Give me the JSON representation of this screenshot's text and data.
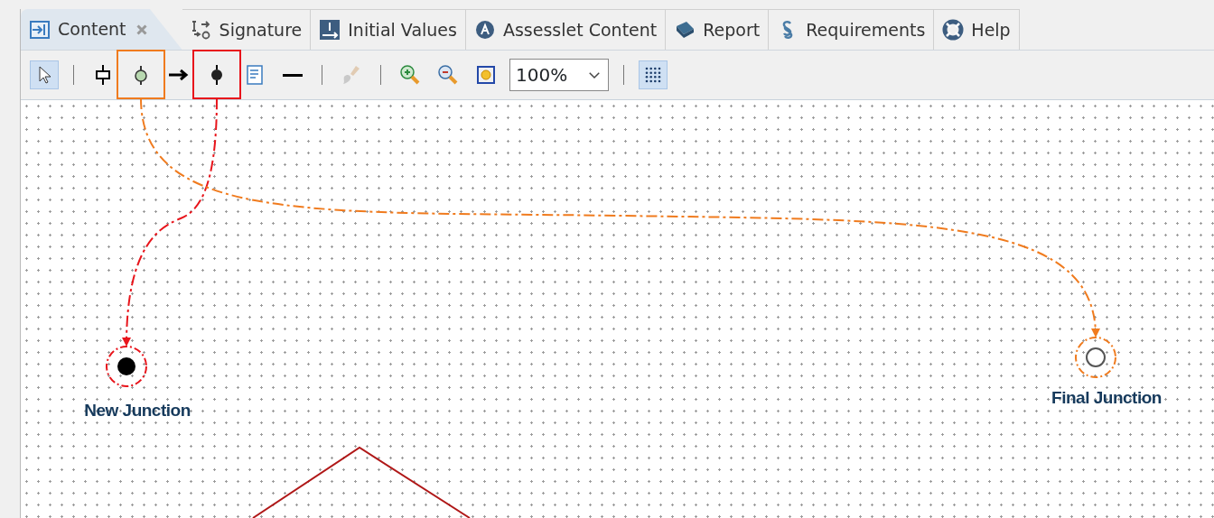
{
  "tabs": [
    {
      "label": "Content",
      "selected": true,
      "closable": true,
      "kind": "content"
    },
    {
      "label": "Signature",
      "selected": false,
      "closable": false,
      "kind": "signature"
    },
    {
      "label": "Initial Values",
      "selected": false,
      "closable": false,
      "kind": "info"
    },
    {
      "label": "Assesslet Content",
      "selected": false,
      "closable": false,
      "kind": "letter"
    },
    {
      "label": "Report",
      "selected": false,
      "closable": false,
      "kind": "book"
    },
    {
      "label": "Requirements",
      "selected": false,
      "closable": false,
      "kind": "section"
    },
    {
      "label": "Help",
      "selected": false,
      "closable": false,
      "kind": "lifebuoy"
    }
  ],
  "toolbar": [
    {
      "kind": "select",
      "pressed": true,
      "disabled": false
    },
    {
      "kind": "separator"
    },
    {
      "kind": "box",
      "pressed": false,
      "disabled": false
    },
    {
      "kind": "circle",
      "pressed": false,
      "disabled": false,
      "color": "#f07b1e"
    },
    {
      "kind": "arrow",
      "pressed": false,
      "disabled": false
    },
    {
      "kind": "junction",
      "pressed": false,
      "disabled": false,
      "color": "#e8141b"
    },
    {
      "kind": "note",
      "pressed": false,
      "disabled": false
    },
    {
      "kind": "line",
      "pressed": false,
      "disabled": false
    },
    {
      "kind": "separator"
    },
    {
      "kind": "brush",
      "pressed": false,
      "disabled": true
    },
    {
      "kind": "separator"
    },
    {
      "kind": "zoomin",
      "pressed": false,
      "disabled": false
    },
    {
      "kind": "zoomout",
      "pressed": false,
      "disabled": false
    },
    {
      "kind": "fit",
      "pressed": false,
      "disabled": false
    },
    {
      "kind": "zoom",
      "value": "100%"
    },
    {
      "kind": "separator"
    },
    {
      "kind": "grid",
      "pressed": true,
      "disabled": false
    }
  ],
  "nodes": [
    {
      "label": "New Junction",
      "kind": "filled",
      "color": "#e8141b"
    },
    {
      "label": "Final Junction",
      "kind": "hollow",
      "color": "#f07b1e"
    }
  ]
}
